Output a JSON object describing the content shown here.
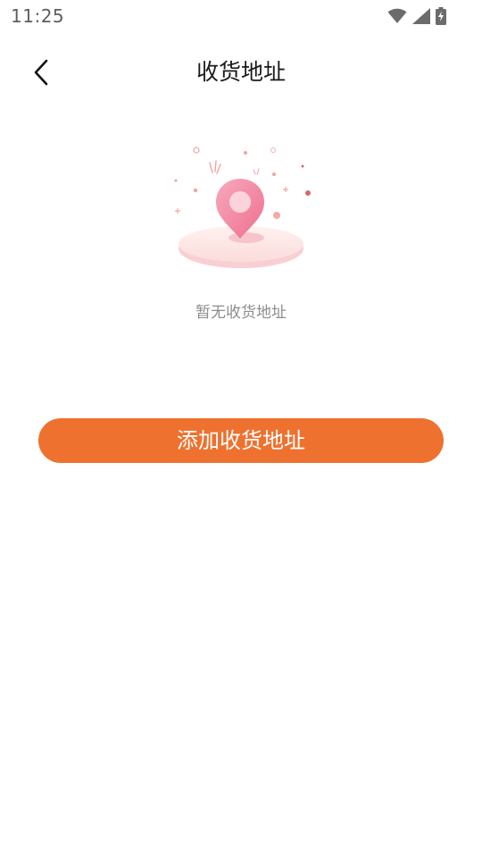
{
  "status_bar": {
    "time": "11:25",
    "icons": [
      "wifi-icon",
      "cellular-signal-icon",
      "battery-charging-icon"
    ]
  },
  "header": {
    "back_icon": "chevron-left-icon",
    "title": "收货地址"
  },
  "empty_state": {
    "illustration_icon": "location-pin-icon",
    "message": "暂无收货地址"
  },
  "actions": {
    "add_address_label": "添加收货地址"
  },
  "colors": {
    "accent": "#ee712f",
    "pin_pink": "#f07a9a",
    "platform": "#fde3e3",
    "muted_text": "#8d8d8d"
  }
}
